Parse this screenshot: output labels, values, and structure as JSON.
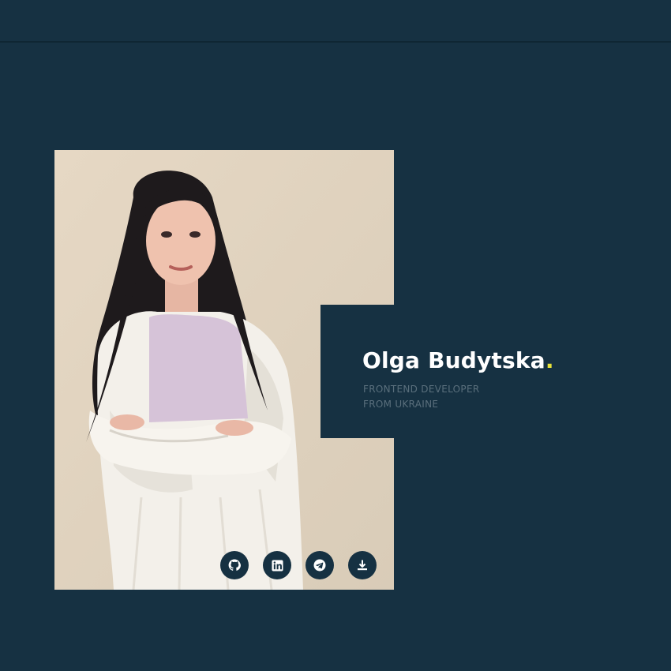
{
  "hero": {
    "name": "Olga Budytska",
    "name_dot": ".",
    "subtitle_line1": "FRONTEND DEVELOPER",
    "subtitle_line2": "FROM UKRAINE",
    "photo_alt": "Portrait of Olga Budytska"
  },
  "socials": [
    {
      "icon": "github-icon",
      "label": "GitHub"
    },
    {
      "icon": "linkedin-icon",
      "label": "LinkedIn"
    },
    {
      "icon": "telegram-icon",
      "label": "Telegram"
    },
    {
      "icon": "download-icon",
      "label": "Download CV"
    }
  ],
  "colors": {
    "background": "#163142",
    "accent_dot": "#e8e23a",
    "name": "#ffffff",
    "subtitle": "#5a6f7c"
  }
}
